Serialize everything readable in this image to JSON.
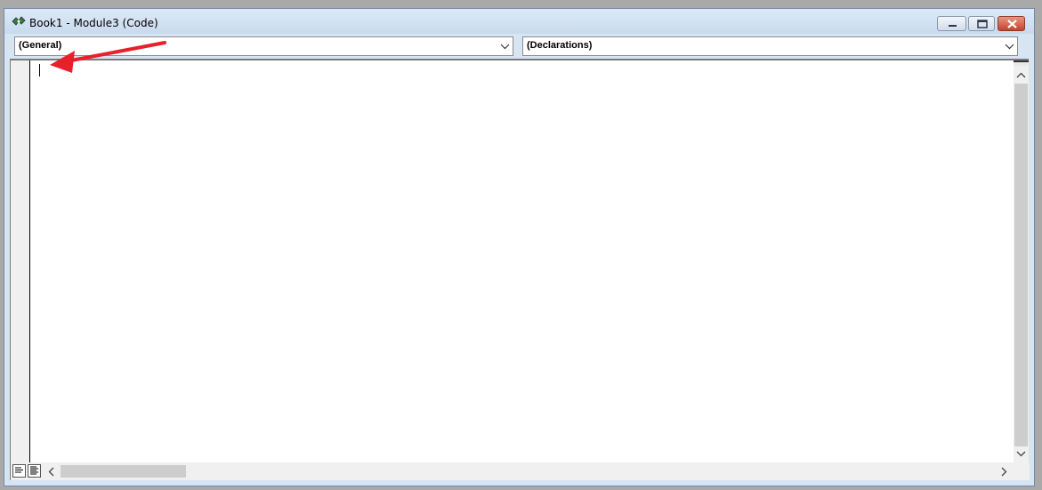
{
  "window": {
    "title": "Book1 - Module3 (Code)"
  },
  "combos": {
    "object": "(General)",
    "procedure": "(Declarations)"
  },
  "colors": {
    "title_bar": "#c9daed",
    "close_button": "#c5432c",
    "annotation_arrow": "#e8202a"
  },
  "icons": {
    "app": "vba-code-icon",
    "minimize": "minimize-icon",
    "maximize": "restore-icon",
    "close": "close-icon",
    "dropdown": "chevron-down-icon",
    "procedure_view": "procedure-view-icon",
    "full_module_view": "full-module-view-icon",
    "scroll_up": "scroll-up-icon",
    "scroll_down": "scroll-down-icon",
    "scroll_left": "scroll-left-icon",
    "scroll_right": "scroll-right-icon"
  }
}
